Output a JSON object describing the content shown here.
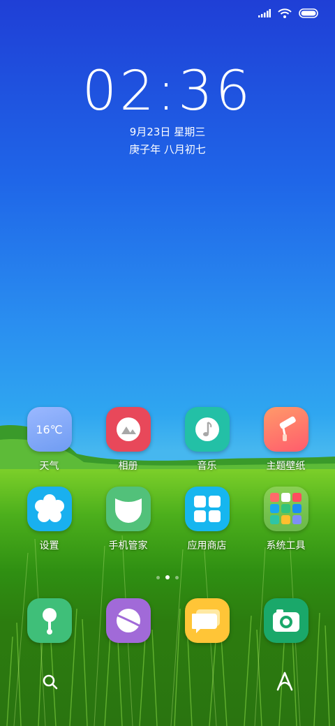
{
  "status_bar": {
    "icons": [
      "signal-icon",
      "wifi-icon",
      "battery-icon"
    ]
  },
  "lock": {
    "time": "02:36",
    "date": "9月23日 星期三",
    "lunar": "庚子年 八月初七"
  },
  "apps": [
    {
      "label": "天气",
      "icon": "weather-icon",
      "text": "16℃",
      "color": "#7aa6f5"
    },
    {
      "label": "相册",
      "icon": "gallery-icon",
      "color": "#e8485a"
    },
    {
      "label": "音乐",
      "icon": "music-icon",
      "color": "#23c0a6"
    },
    {
      "label": "主题壁纸",
      "icon": "theme-paint-roller-icon",
      "color": "#ff7a63"
    },
    {
      "label": "设置",
      "icon": "settings-flower-icon",
      "color": "#19b0ef"
    },
    {
      "label": "手机管家",
      "icon": "security-icon",
      "color": "#52c17a"
    },
    {
      "label": "应用商店",
      "icon": "app-store-icon",
      "color": "#16b6ef"
    },
    {
      "label": "系统工具",
      "icon": "folder-icon",
      "color": "#ffffff"
    }
  ],
  "page_indicator": {
    "pages": 3,
    "active": 1
  },
  "dock": [
    {
      "name": "phone",
      "icon": "phone-icon",
      "color": "#3fbf79"
    },
    {
      "name": "browser",
      "icon": "browser-icon",
      "color": "#a16ad8"
    },
    {
      "name": "messages",
      "icon": "messages-icon",
      "color": "#ffc537"
    },
    {
      "name": "camera",
      "icon": "camera-icon",
      "color": "#1aa86a"
    }
  ],
  "bottom": {
    "left_icon": "search-icon",
    "right_icon": "assistant-icon"
  }
}
